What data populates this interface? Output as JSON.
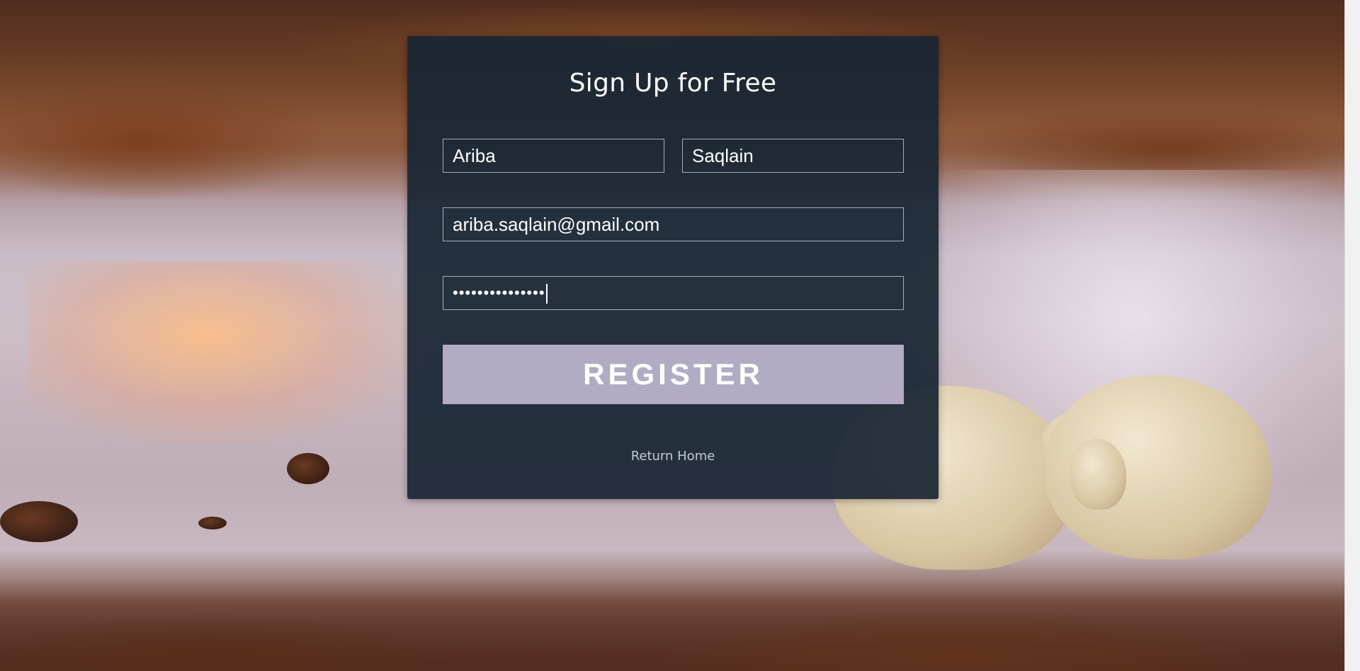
{
  "form": {
    "title": "Sign Up for Free",
    "first_name_value": "Ariba",
    "last_name_value": "Saqlain",
    "email_value": "ariba.saqlain@gmail.com",
    "password_masked": "•••••••••••••••",
    "register_label": "REGISTER",
    "return_home_label": "Return Home"
  },
  "colors": {
    "card_background": "#192634",
    "register_button": "#b1abc4",
    "text": "#ffffff",
    "link": "#c3c9d2"
  },
  "background": {
    "icon": "polar-bears-photo"
  }
}
